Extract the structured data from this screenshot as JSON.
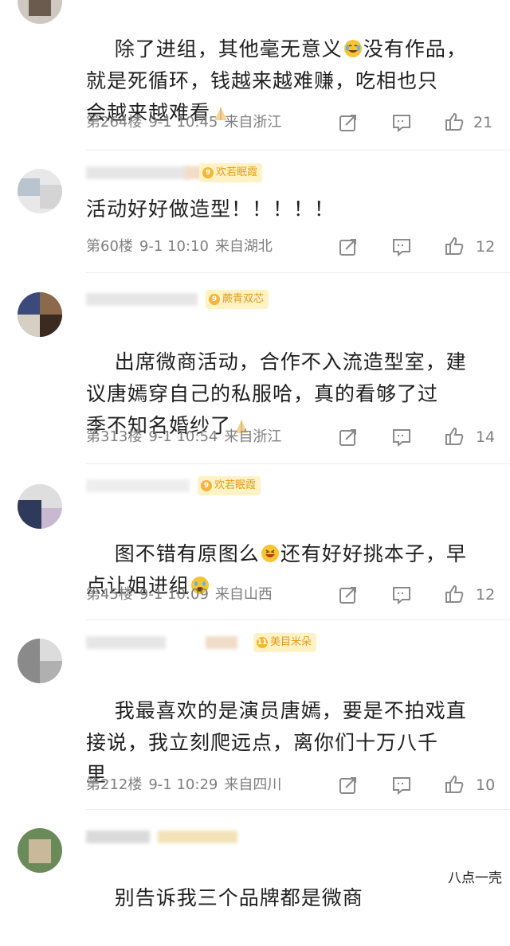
{
  "comments": [
    {
      "text": "除了进组，其他毫无意义😂没有作品，就是死循环，钱越来越难赚，吃相也只会越来越难看🙏",
      "text_lines": [
        "除了进组，其他毫无意义",
        "没有作品，",
        "就是死循环，钱越来越难赚，吃相也只",
        "会越来越难看"
      ],
      "floor": "第264楼",
      "date": "9-1 10:45",
      "location": "来自浙江",
      "likes": "21"
    },
    {
      "badge": "欢若眠霞",
      "text": "活动好好做造型！！！！！",
      "floor": "第60楼",
      "date": "9-1 10:10",
      "location": "来自湖北",
      "likes": "12"
    },
    {
      "badge": "蕨青双芯",
      "text_lines": [
        "出席微商活动，合作不入流造型室，建",
        "议唐嫣穿自己的私服哈，真的看够了过",
        "季不知名婚纱了"
      ],
      "floor": "第313楼",
      "date": "9-1 10:54",
      "location": "来自浙江",
      "likes": "14"
    },
    {
      "badge": "欢若眠霞",
      "text_lines": [
        "图不错有原图么",
        "还有好好挑本子，早",
        "点让姐进组"
      ],
      "floor": "第45楼",
      "date": "9-1 10:09",
      "location": "来自山西",
      "likes": "12"
    },
    {
      "badge": "美目米朵",
      "text_lines": [
        "我最喜欢的是演员唐嫣，要是不拍戏直",
        "接说，我立刻爬远点，离你们十万八千",
        "里"
      ],
      "floor": "第212楼",
      "date": "9-1 10:29",
      "location": "来自四川",
      "likes": "10"
    },
    {
      "text_lines": [
        "别告诉我三个品牌都是微商"
      ]
    }
  ],
  "watermark": "八点一壳",
  "colors": {
    "meta": "#7f7f7f",
    "badge_bg": "#fff2c4",
    "badge_text": "#e39b1c"
  },
  "icons": [
    "share-icon",
    "comment-icon",
    "like-icon"
  ]
}
